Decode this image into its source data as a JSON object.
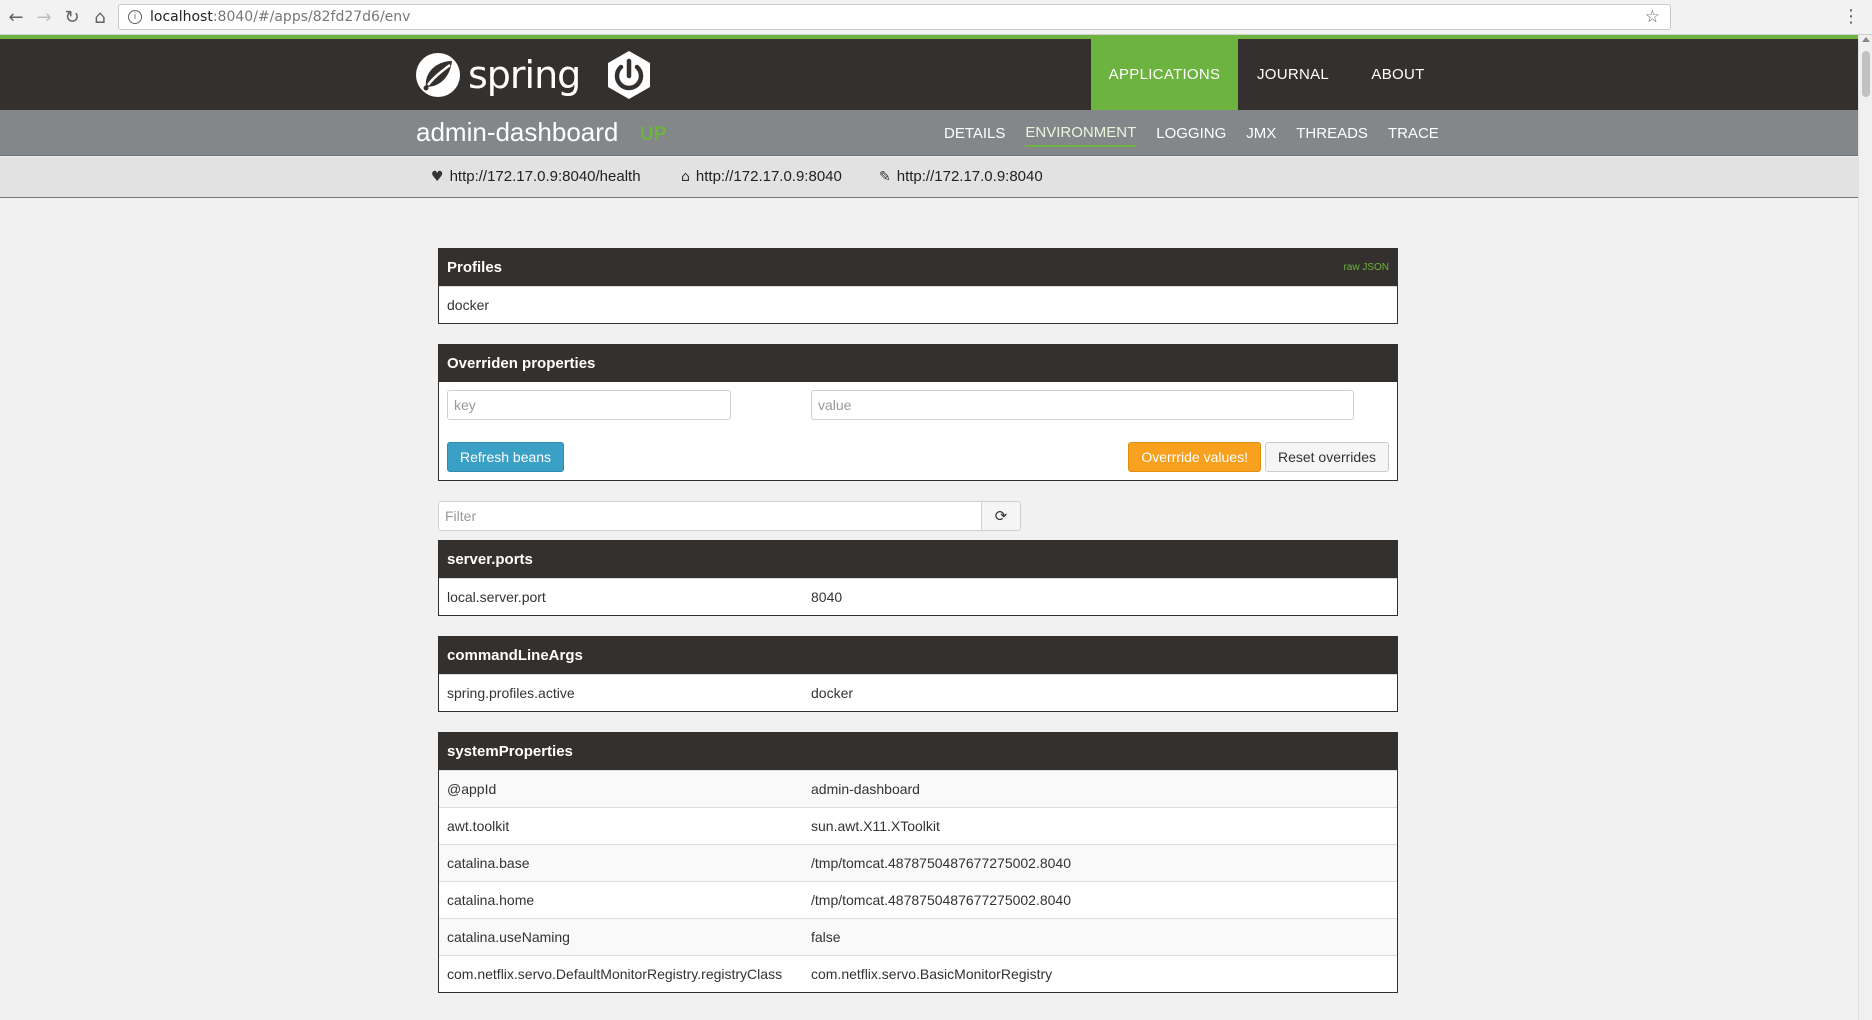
{
  "browser": {
    "url_host": "localhost",
    "url_path": ":8040/#/apps/82fd27d6/env"
  },
  "header": {
    "brand": "spring",
    "nav": [
      {
        "label": "APPLICATIONS",
        "active": true
      },
      {
        "label": "JOURNAL",
        "active": false
      },
      {
        "label": "ABOUT",
        "active": false
      }
    ]
  },
  "app": {
    "name": "admin-dashboard",
    "status": "UP",
    "tabs": [
      {
        "label": "DETAILS"
      },
      {
        "label": "ENVIRONMENT",
        "active": true
      },
      {
        "label": "LOGGING"
      },
      {
        "label": "JMX"
      },
      {
        "label": "THREADS"
      },
      {
        "label": "TRACE"
      }
    ],
    "urls": {
      "health": "http://172.17.0.9:8040/health",
      "home": "http://172.17.0.9:8040",
      "management": "http://172.17.0.9:8040"
    }
  },
  "profiles": {
    "title": "Profiles",
    "raw_json": "raw JSON",
    "value": "docker"
  },
  "overrides": {
    "title": "Overriden properties",
    "key_placeholder": "key",
    "value_placeholder": "value",
    "refresh_label": "Refresh beans",
    "override_label": "Overrride values!",
    "reset_label": "Reset overrides"
  },
  "filter": {
    "placeholder": "Filter"
  },
  "sections": [
    {
      "title": "server.ports",
      "rows": [
        {
          "key": "local.server.port",
          "value": "8040"
        }
      ]
    },
    {
      "title": "commandLineArgs",
      "rows": [
        {
          "key": "spring.profiles.active",
          "value": "docker"
        }
      ]
    },
    {
      "title": "systemProperties",
      "rows": [
        {
          "key": "@appId",
          "value": "admin-dashboard"
        },
        {
          "key": "awt.toolkit",
          "value": "sun.awt.X11.XToolkit"
        },
        {
          "key": "catalina.base",
          "value": "/tmp/tomcat.4878750487677275002.8040"
        },
        {
          "key": "catalina.home",
          "value": "/tmp/tomcat.4878750487677275002.8040"
        },
        {
          "key": "catalina.useNaming",
          "value": "false"
        },
        {
          "key": "com.netflix.servo.DefaultMonitorRegistry.registryClass",
          "value": "com.netflix.servo.BasicMonitorRegistry"
        }
      ]
    }
  ],
  "colors": {
    "spring_green": "#6db33f",
    "header_dark": "#34302d",
    "subheader_gray": "#838789"
  }
}
